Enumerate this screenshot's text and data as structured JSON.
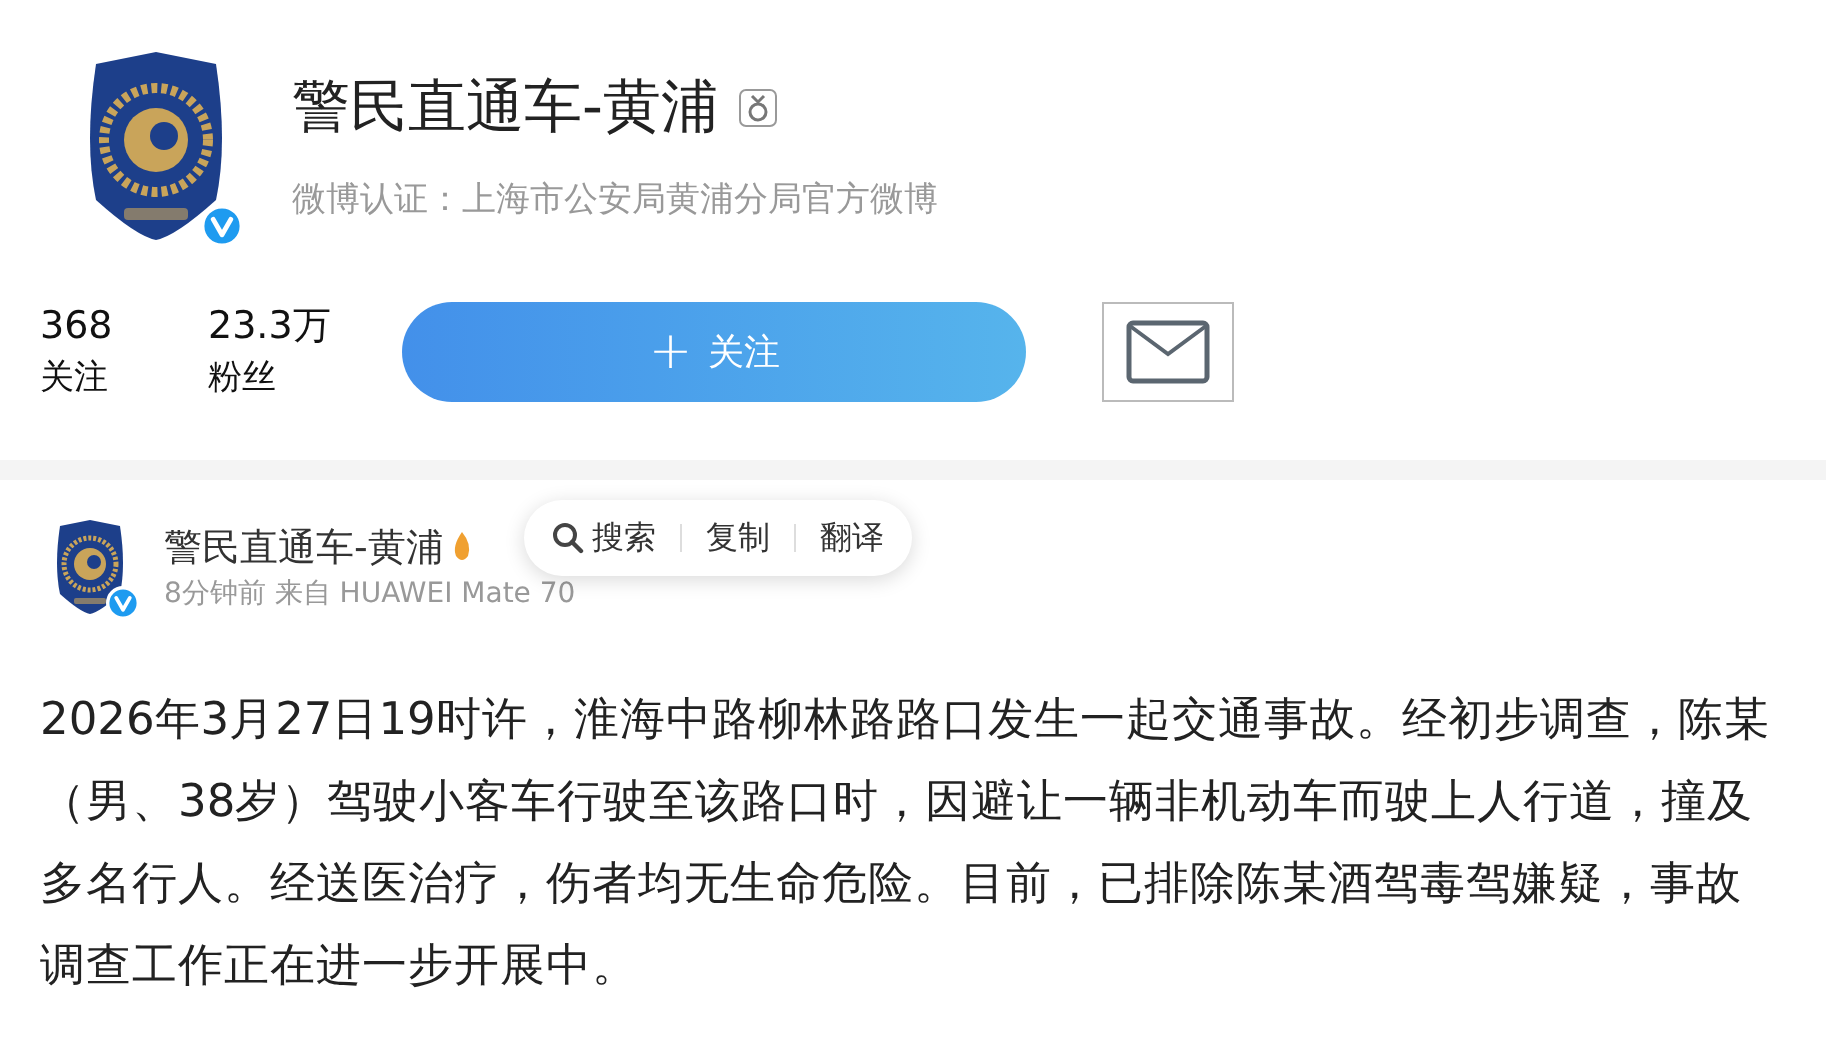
{
  "profile": {
    "name": "警民直通车-黄浦",
    "verified": true,
    "verification": "微博认证：上海市公安局黄浦分局官方微博"
  },
  "stats": [
    {
      "value": "368",
      "label": "关注"
    },
    {
      "value": "23.3万",
      "label": "粉丝"
    }
  ],
  "follow_button": {
    "icon": "+",
    "label": "关注"
  },
  "post": {
    "author": "警民直通车-黄浦",
    "verified": true,
    "meta": "8分钟前 来自 HUAWEI Mate 70",
    "text": "2026年3月27日19时许，淮海中路柳林路路口发生一起交通事故。经初步调查，陈某（男、38岁）驾驶小客车行驶至该路口时，因避让一辆非机动车而驶上人行道，撞及多名行人。经送医治疗，伤者均无生命危险。目前，已排除陈某酒驾毒驾嫌疑，事故调查工作正在进一步开展中。"
  },
  "context_menu": [
    "搜索",
    "复制",
    "翻译"
  ]
}
